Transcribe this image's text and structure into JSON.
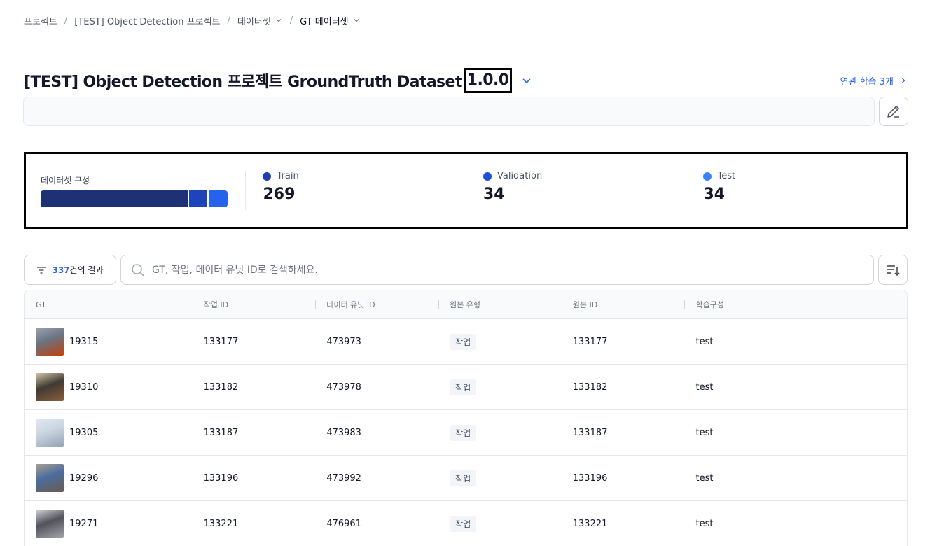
{
  "breadcrumb": {
    "items": [
      {
        "label": "프로젝트",
        "has_dropdown": false
      },
      {
        "label": "[TEST] Object Detection 프로젝트",
        "has_dropdown": false
      },
      {
        "label": "데이터셋",
        "has_dropdown": true
      },
      {
        "label": "GT 데이터셋",
        "has_dropdown": true
      }
    ],
    "separator": "/"
  },
  "header": {
    "title": "[TEST] Object Detection 프로젝트 GroundTruth Dataset",
    "version": "1.0.0",
    "related_link": "연관 학습 3개"
  },
  "description": {
    "value": "",
    "placeholder": ""
  },
  "composition": {
    "label": "데이터셋 구성",
    "stats": [
      {
        "name": "Train",
        "value": "269",
        "count": 269,
        "color": "#1e3a8a"
      },
      {
        "name": "Validation",
        "value": "34",
        "count": 34,
        "color": "#1d4ed8"
      },
      {
        "name": "Test",
        "value": "34",
        "count": 34,
        "color": "#3b82f6"
      }
    ],
    "bar_colors": [
      "#1e3174",
      "#1d44b8",
      "#2563eb"
    ]
  },
  "filter": {
    "count": "337",
    "suffix": "건의 결과",
    "search_placeholder": "GT, 작업, 데이터 유닛 ID로 검색하세요."
  },
  "table": {
    "columns": [
      "GT",
      "작업 ID",
      "데이터 유닛 ID",
      "원본 유형",
      "원본 ID",
      "학습구성"
    ],
    "rows": [
      {
        "gt": "19315",
        "task_id": "133177",
        "data_unit_id": "473973",
        "source_type": "작업",
        "source_id": "133177",
        "split": "test",
        "thumb": [
          "#6b7280",
          "#c2410c",
          "#9ca3af"
        ]
      },
      {
        "gt": "19310",
        "task_id": "133182",
        "data_unit_id": "473978",
        "source_type": "작업",
        "source_id": "133182",
        "split": "test",
        "thumb": [
          "#3f3a33",
          "#8b5e3c",
          "#d4c4a8"
        ]
      },
      {
        "gt": "19305",
        "task_id": "133187",
        "data_unit_id": "473983",
        "source_type": "작업",
        "source_id": "133187",
        "split": "test",
        "thumb": [
          "#cbd5e1",
          "#94a3b8",
          "#e2e8f0"
        ]
      },
      {
        "gt": "19296",
        "task_id": "133196",
        "data_unit_id": "473992",
        "source_type": "작업",
        "source_id": "133196",
        "split": "test",
        "thumb": [
          "#4b6c9e",
          "#6b5d4f",
          "#a89f91"
        ]
      },
      {
        "gt": "19271",
        "task_id": "133221",
        "data_unit_id": "476961",
        "source_type": "작업",
        "source_id": "133221",
        "split": "test",
        "thumb": [
          "#52525b",
          "#a1a1aa",
          "#d4d4d8"
        ]
      }
    ]
  }
}
